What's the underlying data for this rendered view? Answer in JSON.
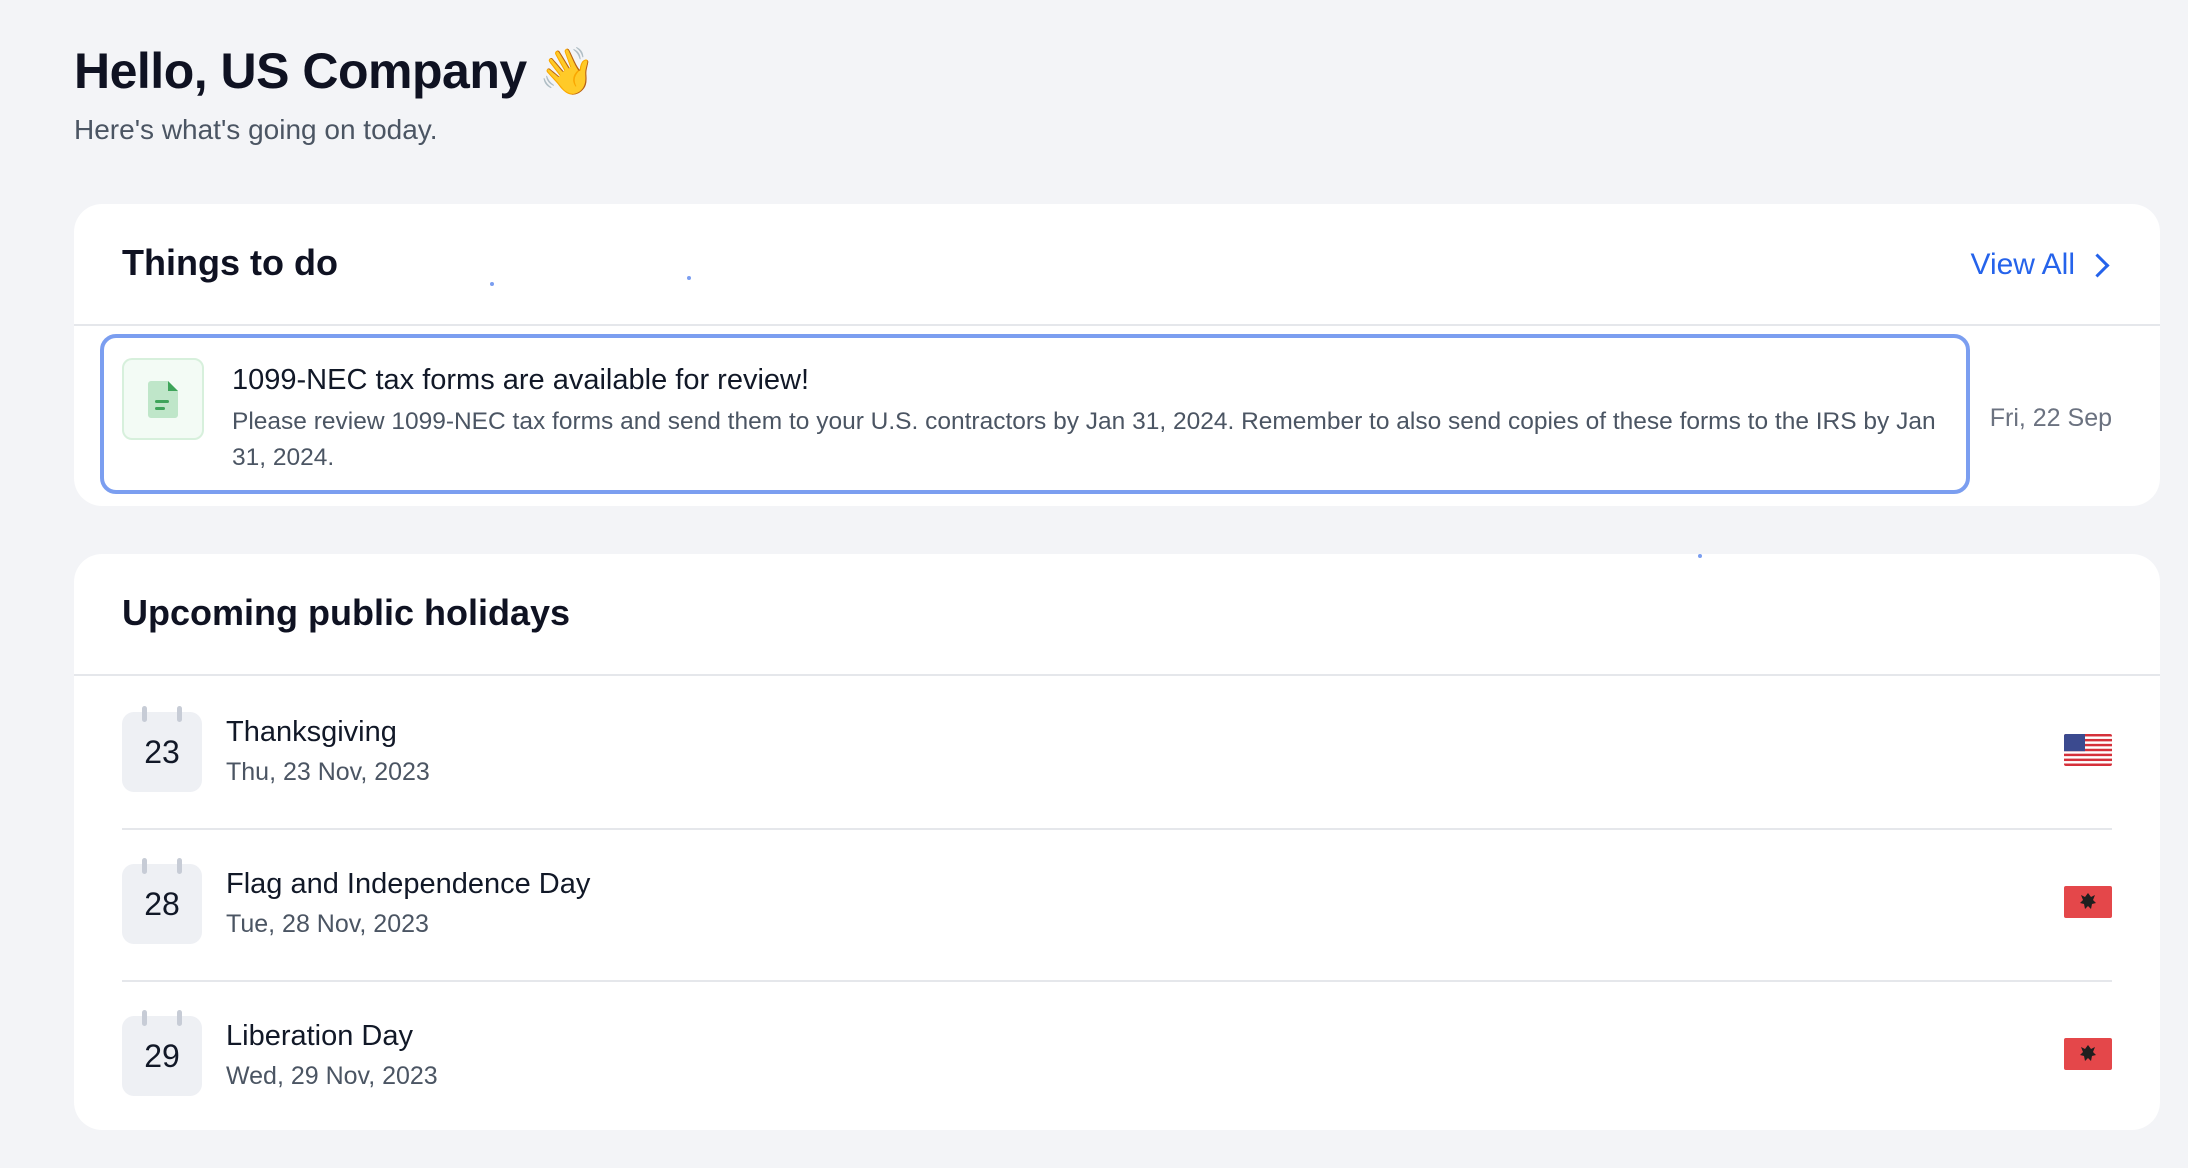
{
  "header": {
    "greeting": "Hello, US Company",
    "wave_emoji": "👋",
    "subtitle": "Here's what's going on today."
  },
  "todo": {
    "title": "Things to do",
    "view_all": "View All",
    "items": [
      {
        "icon": "document-icon",
        "title": "1099-NEC tax forms are available for review!",
        "description": "Please review 1099-NEC tax forms and send them to your U.S. contractors by Jan 31, 2024. Remember to also send copies of these forms to the IRS by Jan 31, 2024.",
        "date": "Fri, 22 Sep"
      }
    ]
  },
  "holidays": {
    "title": "Upcoming public holidays",
    "items": [
      {
        "day": "23",
        "name": "Thanksgiving",
        "date": "Thu, 23 Nov, 2023",
        "flag": "us-flag-icon"
      },
      {
        "day": "28",
        "name": "Flag and Independence Day",
        "date": "Tue, 28 Nov, 2023",
        "flag": "albania-flag-icon"
      },
      {
        "day": "29",
        "name": "Liberation Day",
        "date": "Wed, 29 Nov, 2023",
        "flag": "albania-flag-icon"
      }
    ]
  },
  "colors": {
    "background": "#f3f4f7",
    "accent": "#2563eb",
    "focus_outline": "#7b9ef0",
    "albania_red": "#e4474a"
  }
}
